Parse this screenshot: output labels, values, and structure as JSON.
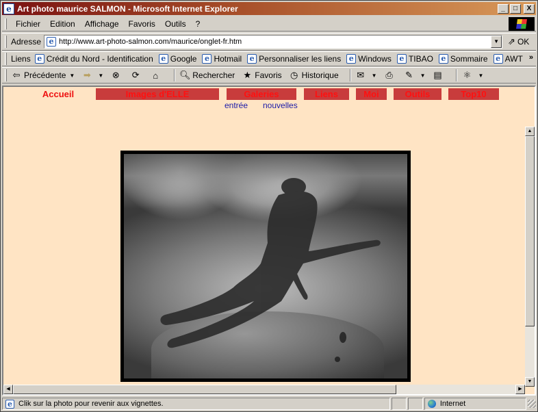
{
  "window": {
    "title": "Art photo maurice SALMON - Microsoft Internet Explorer",
    "buttons": {
      "minimize": "_",
      "maximize": "□",
      "close": "X"
    }
  },
  "menu": [
    "Fichier",
    "Edition",
    "Affichage",
    "Favoris",
    "Outils",
    "?"
  ],
  "address": {
    "label": "Adresse",
    "url": "http://www.art-photo-salmon.com/maurice/onglet-fr.htm",
    "go_label": "OK"
  },
  "links": {
    "label": "Liens",
    "items": [
      "Crédit du Nord - Identification",
      "Google",
      "Hotmail",
      "Personnaliser les liens",
      "Windows",
      "TIBAO",
      "Sommaire",
      "AWT"
    ],
    "more": "»"
  },
  "toolbar": {
    "back": "Précédente",
    "search": "Rechercher",
    "favorites": "Favoris",
    "history": "Historique"
  },
  "page": {
    "nav": [
      "Accueil",
      "Images d'ELLE",
      "Galeries",
      "Liens",
      "Moi",
      "Outils",
      "Top10"
    ],
    "active_tab": "Accueil",
    "subnav": [
      "entrée",
      "nouvelles"
    ],
    "colors": {
      "background": "#ffe4c4",
      "tab": "#c83c3c",
      "tab_text": "#ff1010",
      "subnav": "#1a1aa8"
    }
  },
  "status": {
    "message": "Clik sur la photo pour revenir aux vignettes.",
    "zone": "Internet"
  }
}
